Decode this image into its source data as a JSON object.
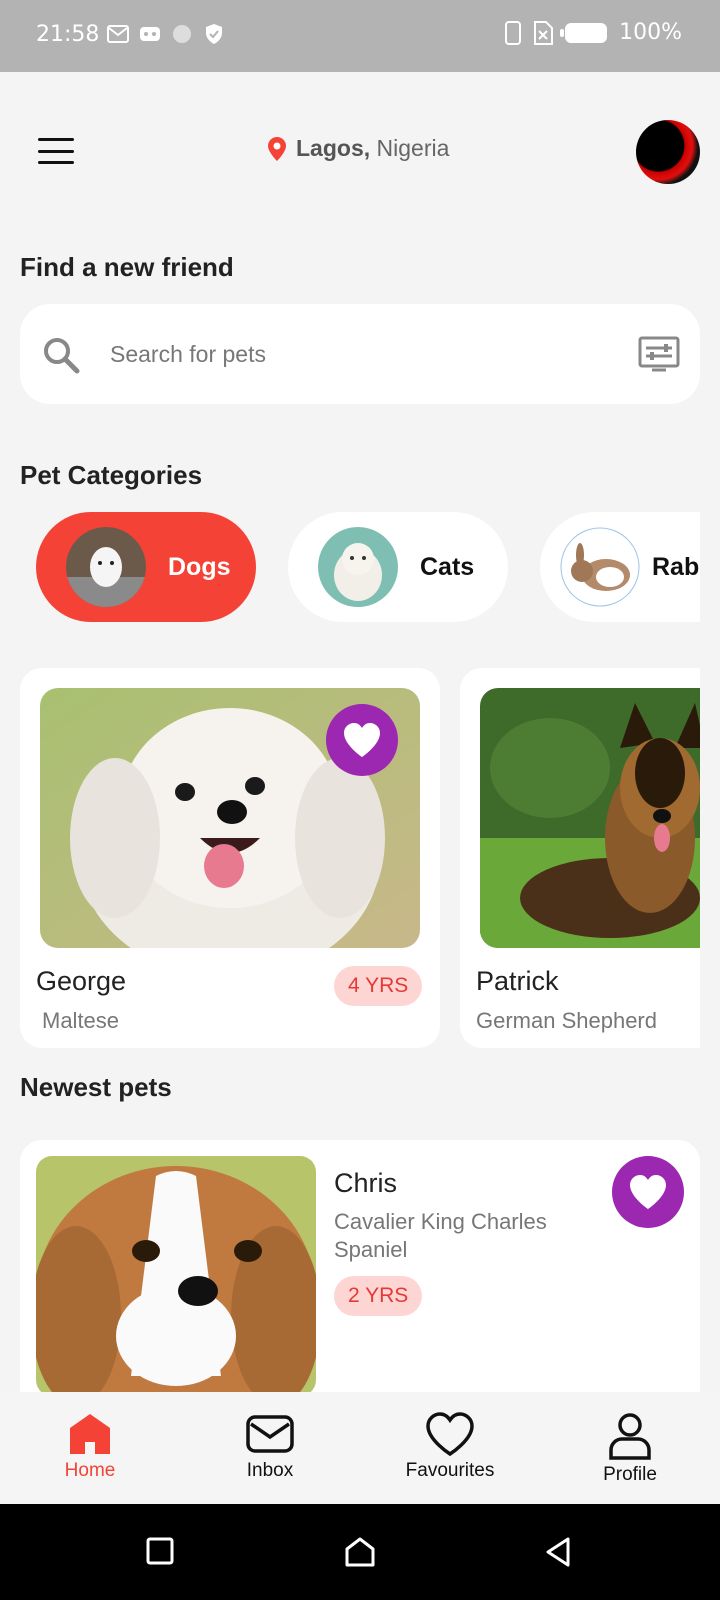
{
  "status_bar": {
    "time": "21:58",
    "battery": "100%"
  },
  "header": {
    "city": "Lagos,",
    "country": "Nigeria"
  },
  "find_section": {
    "title": "Find a new friend",
    "search_placeholder": "Search for pets"
  },
  "categories_section": {
    "title": "Pet Categories",
    "items": [
      {
        "label": "Dogs",
        "active": true
      },
      {
        "label": "Cats",
        "active": false
      },
      {
        "label": "Rabb",
        "active": false
      }
    ]
  },
  "featured_pets": [
    {
      "name": "George",
      "breed": "Maltese",
      "age": "4 YRS"
    },
    {
      "name": "Patrick",
      "breed": "German Shepherd"
    }
  ],
  "newest_section": {
    "title": "Newest pets",
    "pet": {
      "name": "Chris",
      "breed": "Cavalier King Charles Spaniel",
      "age": "2 YRS"
    }
  },
  "bottom_nav": [
    {
      "label": "Home"
    },
    {
      "label": "Inbox"
    },
    {
      "label": "Favourites"
    },
    {
      "label": "Profile"
    }
  ],
  "colors": {
    "accent": "#f44336",
    "favorite": "#9c27b0",
    "age_bg": "#fdd6d3"
  }
}
